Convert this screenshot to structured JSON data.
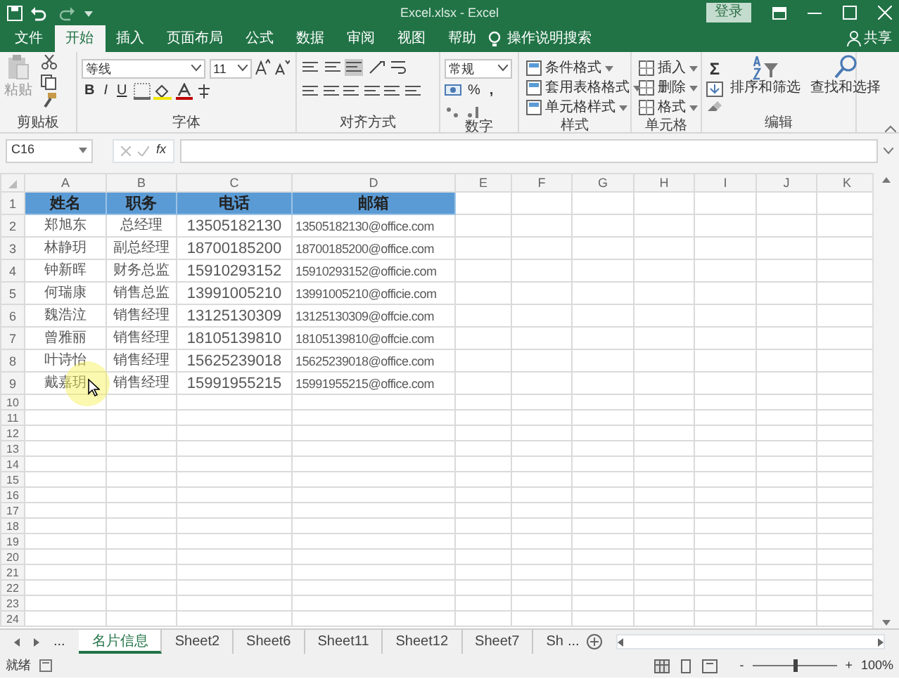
{
  "title_bar": {
    "title": "Excel.xlsx  -  Excel",
    "login": "登录"
  },
  "ribbon_tabs": [
    {
      "label": "文件",
      "selected": false
    },
    {
      "label": "开始",
      "selected": true
    },
    {
      "label": "插入",
      "selected": false
    },
    {
      "label": "页面布局",
      "selected": false
    },
    {
      "label": "公式",
      "selected": false
    },
    {
      "label": "数据",
      "selected": false
    },
    {
      "label": "审阅",
      "selected": false
    },
    {
      "label": "视图",
      "selected": false
    },
    {
      "label": "帮助",
      "selected": false
    }
  ],
  "tell_me": "操作说明搜索",
  "share": "共享",
  "clipboard": {
    "label": "剪贴板",
    "paste": "粘贴"
  },
  "font": {
    "label": "字体",
    "font_name": "等线",
    "font_size": "11",
    "bold": "B",
    "italic": "I",
    "underline": "U"
  },
  "alignment": {
    "label": "对齐方式"
  },
  "number": {
    "label": "数字",
    "format": "常规",
    "percent": "%",
    "comma": ","
  },
  "styles": {
    "label": "样式",
    "items": [
      "条件格式",
      "套用表格格式",
      "单元格样式"
    ]
  },
  "cells": {
    "label": "单元格",
    "items": [
      "插入",
      "删除",
      "格式"
    ]
  },
  "editing": {
    "label": "编辑",
    "sigma": "Σ",
    "items": [
      "排序和筛选",
      "查找和选择"
    ]
  },
  "formula_bar": {
    "name_box": "C16",
    "fx": "fx"
  },
  "columns": [
    "A",
    "B",
    "C",
    "D",
    "E",
    "F",
    "G",
    "H",
    "I",
    "J",
    "K"
  ],
  "header_row": [
    "姓名",
    "职务",
    "电话",
    "邮箱"
  ],
  "rows": [
    [
      "郑旭东",
      "总经理",
      "13505182130",
      "13505182130@office.com"
    ],
    [
      "林静玥",
      "副总经理",
      "18700185200",
      "18700185200@office.com"
    ],
    [
      "钟新晖",
      "财务总监",
      "15910293152",
      "15910293152@officie.com"
    ],
    [
      "何瑞康",
      "销售总监",
      "13991005210",
      "13991005210@officie.com"
    ],
    [
      "魏浩泣",
      "销售经理",
      "13125130309",
      "13125130309@offcie.com"
    ],
    [
      "曾雅丽",
      "销售经理",
      "18105139810",
      "18105139810@offcie.com"
    ],
    [
      "叶诗怡",
      "销售经理",
      "15625239018",
      "15625239018@office.com"
    ],
    [
      "戴嘉玥",
      "销售经理",
      "15991955215",
      "15991955215@office.com"
    ]
  ],
  "row_numbers": [
    "1",
    "2",
    "3",
    "4",
    "5",
    "6",
    "7",
    "8",
    "9",
    "10",
    "11",
    "12",
    "13",
    "14",
    "15",
    "16",
    "17",
    "18",
    "19",
    "20",
    "21",
    "22",
    "23",
    "24"
  ],
  "sheet_nav": {
    "more_left": "...",
    "more_right": "..."
  },
  "sheet_tabs": [
    {
      "label": "名片信息",
      "selected": true
    },
    {
      "label": "Sheet2",
      "selected": false
    },
    {
      "label": "Sheet6",
      "selected": false
    },
    {
      "label": "Sheet11",
      "selected": false
    },
    {
      "label": "Sheet12",
      "selected": false
    },
    {
      "label": "Sheet7",
      "selected": false
    },
    {
      "label": "Sh",
      "selected": false
    }
  ],
  "status_bar": {
    "status": "就绪",
    "zoom_out": "-",
    "zoom_in": "+",
    "zoom": "100%",
    "zoom_slider": {
      "level": 0.5
    }
  }
}
